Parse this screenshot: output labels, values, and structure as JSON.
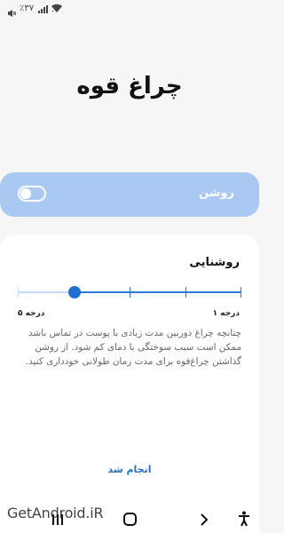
{
  "status_bar": {
    "battery_text": "٪۳۷",
    "icons": [
      "notification-mute-icon",
      "wifi-icon",
      "signal-icon"
    ]
  },
  "page": {
    "title": "چراغ قوه"
  },
  "toggle": {
    "label": "روشن",
    "state": "off"
  },
  "brightness": {
    "title": "روشنایی",
    "min_label": "درجه ۱",
    "max_label": "درجه ۵",
    "levels": 5,
    "current_level_from_right": 4,
    "description": "چنانچه چراغ دوربین مدت زیادی با پوست در تماس باشد ممکن است سبب سوختگی با دمای کم شود. از روشن گذاشتن چراغ‌قوه برای مدت زمان طولانی خودداری کنید."
  },
  "actions": {
    "done_label": "انجام شد"
  },
  "nav": {
    "icons": [
      "recents-icon",
      "home-icon",
      "back-icon",
      "accessibility-icon"
    ]
  },
  "watermark": "GetAndroid.iR",
  "colors": {
    "accent": "#2b7bd4",
    "toggle_bg": "#a9c9f3",
    "background": "#f6f6f6"
  }
}
